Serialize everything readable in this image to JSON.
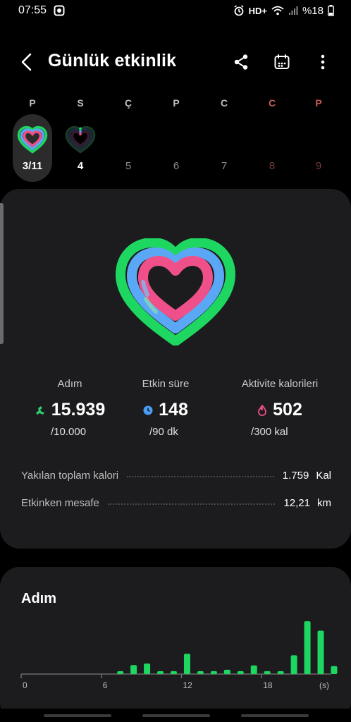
{
  "status_bar": {
    "time": "07:55",
    "network": "HD+",
    "battery": "%18",
    "icons": [
      "screenshot-icon",
      "alarm-icon",
      "wifi-icon",
      "signal-icon",
      "battery-icon"
    ]
  },
  "app_bar": {
    "title": "Günlük etkinlik",
    "icons": [
      "back-arrow-icon",
      "share-icon",
      "calendar-icon",
      "more-vert-icon"
    ]
  },
  "week": {
    "days": [
      {
        "letter": "P",
        "number": "3/11",
        "state": "active",
        "weekend": false
      },
      {
        "letter": "S",
        "number": "4",
        "state": "selected",
        "weekend": false
      },
      {
        "letter": "Ç",
        "number": "5",
        "state": "future",
        "weekend": false
      },
      {
        "letter": "P",
        "number": "6",
        "state": "future",
        "weekend": false
      },
      {
        "letter": "C",
        "number": "7",
        "state": "future",
        "weekend": false
      },
      {
        "letter": "C",
        "number": "8",
        "state": "future",
        "weekend": true
      },
      {
        "letter": "P",
        "number": "9",
        "state": "future",
        "weekend": true
      }
    ]
  },
  "summary": {
    "stats": [
      {
        "label": "Adım",
        "value": "15.939",
        "goal": "/10.000",
        "icon": "steps-icon",
        "color": "#2ecc71"
      },
      {
        "label": "Etkin süre",
        "value": "148",
        "goal": "/90 dk",
        "icon": "clock-icon",
        "color": "#4a9cf5"
      },
      {
        "label": "Aktivite kalorileri",
        "value": "502",
        "goal": "/300 kal",
        "icon": "flame-icon",
        "color": "#f0508a"
      }
    ],
    "details": [
      {
        "label": "Yakılan toplam kalori",
        "value": "1.759",
        "unit": "Kal"
      },
      {
        "label": "Etkinken mesafe",
        "value": "12,21",
        "unit": "km"
      }
    ],
    "ring_colors": {
      "outer": "#1ed760",
      "middle": "#5aa8f5",
      "inner": "#f0508a"
    }
  },
  "steps_chart": {
    "title": "Adım",
    "chart_data": {
      "type": "bar",
      "x": [
        0,
        1,
        2,
        3,
        4,
        5,
        6,
        7,
        8,
        9,
        10,
        11,
        12,
        13,
        14,
        15,
        16,
        17,
        18,
        19,
        20,
        21,
        22,
        23
      ],
      "values": [
        0,
        0,
        0,
        0,
        0,
        0,
        0,
        80,
        250,
        290,
        80,
        80,
        560,
        80,
        80,
        120,
        80,
        240,
        80,
        80,
        520,
        1460,
        1200,
        220
      ],
      "xticks": [
        "0",
        "6",
        "12",
        "18"
      ],
      "xtick_positions": [
        0,
        6,
        12,
        18
      ],
      "xunit": "(s)",
      "ylim": [
        0,
        1600
      ],
      "bar_color": "#1ed760"
    }
  }
}
